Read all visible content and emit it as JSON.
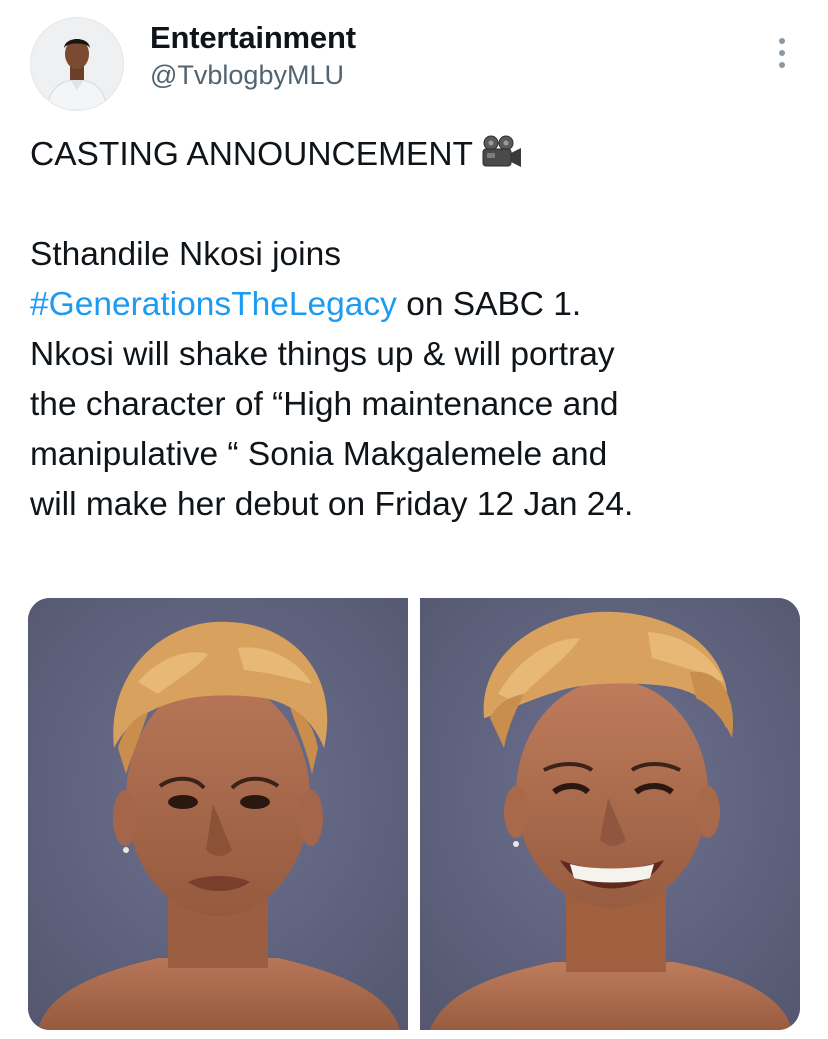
{
  "post": {
    "author": {
      "display_name": "Entertainment",
      "handle": "@TvblogbyMLU",
      "avatar_icon": "user-avatar-icon"
    },
    "more_icon": "more-vertical-icon",
    "text": {
      "line1": "CASTING ANNOUNCEMENT",
      "emoji": "movie-camera-icon",
      "line2": "Sthandile Nkosi joins",
      "hashtag": "#GenerationsTheLegacy",
      "line3_rest": " on SABC 1.",
      "line4": "Nkosi will shake things up & will portray",
      "line5": "the character of “High maintenance and",
      "line6": "manipulative “ Sonia Makgalemele  and",
      "line7": "will make her debut on Friday 12 Jan 24."
    },
    "media": [
      {
        "name": "photo-neutral",
        "expression": "neutral"
      },
      {
        "name": "photo-smiling",
        "expression": "smiling"
      }
    ]
  },
  "colors": {
    "text": "#0f1419",
    "secondary": "#536471",
    "link": "#1d9bf0",
    "photo_background": "#62667e",
    "hair": "#d9a15e",
    "skin": "#a8684a"
  }
}
